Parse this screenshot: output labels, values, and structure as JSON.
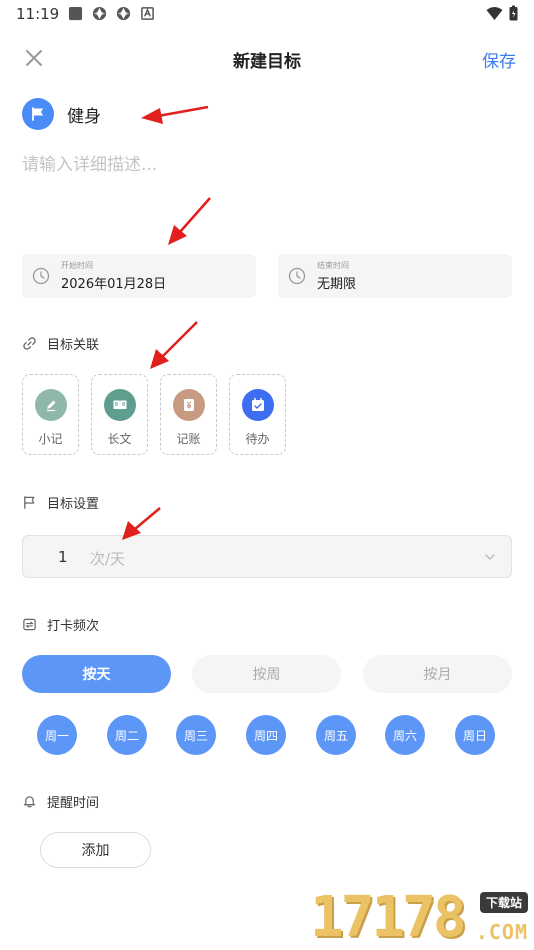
{
  "status_bar": {
    "time": "11:19"
  },
  "app_bar": {
    "title": "新建目标",
    "save_label": "保存"
  },
  "goal": {
    "name": "健身"
  },
  "description": {
    "placeholder": "请输入详细描述..."
  },
  "dates": {
    "start": {
      "label": "开始时间",
      "value": "2026年01月28日"
    },
    "end": {
      "label": "结束时间",
      "value": "无期限"
    }
  },
  "link_section": {
    "title": "目标关联",
    "items": [
      {
        "label": "小记",
        "color": "#8fb8a8"
      },
      {
        "label": "长文",
        "color": "#5f9e8f"
      },
      {
        "label": "记账",
        "color": "#c89a82"
      },
      {
        "label": "待办",
        "color": "#3d6ef2"
      }
    ]
  },
  "target_section": {
    "title": "目标设置",
    "value": "1",
    "unit": "次/天"
  },
  "frequency_section": {
    "title": "打卡频次",
    "options": [
      "按天",
      "按周",
      "按月"
    ],
    "selected": "按天",
    "days": [
      "周一",
      "周二",
      "周三",
      "周四",
      "周五",
      "周六",
      "周日"
    ]
  },
  "reminder_section": {
    "title": "提醒时间",
    "add_label": "添加"
  },
  "watermark": {
    "digits": "17178",
    "badge": "下载站",
    "suffix": ".COM"
  },
  "colors": {
    "accent": "#3a7cf6",
    "primary_button": "#5c96f7",
    "annotation_arrow": "#e0201c"
  }
}
